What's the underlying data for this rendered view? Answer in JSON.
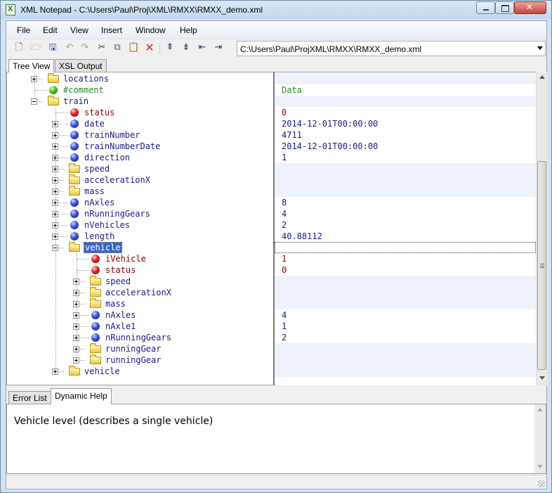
{
  "window": {
    "title": "XML Notepad - C:\\Users\\Paul\\Proj\\XML\\RMXX\\RMXX_demo.xml"
  },
  "menu": [
    "File",
    "Edit",
    "View",
    "Insert",
    "Window",
    "Help"
  ],
  "toolbar": {
    "icons": [
      "new-file-icon",
      "open-folder-icon",
      "save-icon",
      "undo-icon",
      "redo-icon",
      "cut-icon",
      "copy-icon",
      "paste-icon",
      "delete-icon",
      "nudge-up-icon",
      "nudge-down-icon",
      "nudge-left-icon",
      "nudge-right-icon"
    ],
    "path_value": "C:\\Users\\Paul\\ProjXML\\RMXX\\RMXX_demo.xml"
  },
  "tabs_top": [
    "Tree View",
    "XSL Output"
  ],
  "active_tab_top": "Tree View",
  "tree": [
    {
      "level": 1,
      "expander": "plus",
      "icon": "folder",
      "label": "locations",
      "kind": "el",
      "value": ""
    },
    {
      "level": 1,
      "expander": "none",
      "icon": "green",
      "label": "#comment",
      "kind": "comment",
      "value": "Data"
    },
    {
      "level": 1,
      "expander": "minus",
      "icon": "folder",
      "label": "train",
      "kind": "el",
      "value": ""
    },
    {
      "level": 2,
      "expander": "none",
      "icon": "red",
      "label": "status",
      "kind": "attr",
      "value": "0"
    },
    {
      "level": 2,
      "expander": "plus",
      "icon": "blue",
      "label": "date",
      "kind": "el",
      "value": "2014-12-01T00:00:00"
    },
    {
      "level": 2,
      "expander": "plus",
      "icon": "blue",
      "label": "trainNumber",
      "kind": "el",
      "value": "4711"
    },
    {
      "level": 2,
      "expander": "plus",
      "icon": "blue",
      "label": "trainNumberDate",
      "kind": "el",
      "value": "2014-12-01T00:00:00"
    },
    {
      "level": 2,
      "expander": "plus",
      "icon": "blue",
      "label": "direction",
      "kind": "el",
      "value": "1"
    },
    {
      "level": 2,
      "expander": "plus",
      "icon": "folder",
      "label": "speed",
      "kind": "el",
      "value": ""
    },
    {
      "level": 2,
      "expander": "plus",
      "icon": "folder",
      "label": "accelerationX",
      "kind": "el",
      "value": ""
    },
    {
      "level": 2,
      "expander": "plus",
      "icon": "folder",
      "label": "mass",
      "kind": "el",
      "value": ""
    },
    {
      "level": 2,
      "expander": "plus",
      "icon": "blue",
      "label": "nAxles",
      "kind": "el",
      "value": "8"
    },
    {
      "level": 2,
      "expander": "plus",
      "icon": "blue",
      "label": "nRunningGears",
      "kind": "el",
      "value": "4"
    },
    {
      "level": 2,
      "expander": "plus",
      "icon": "blue",
      "label": "nVehicles",
      "kind": "el",
      "value": "2"
    },
    {
      "level": 2,
      "expander": "plus",
      "icon": "blue",
      "label": "length",
      "kind": "el",
      "value": "40.88112"
    },
    {
      "level": 2,
      "expander": "minus",
      "icon": "folder",
      "label": "vehicle",
      "kind": "el",
      "value": "",
      "selected": true
    },
    {
      "level": 3,
      "expander": "none",
      "icon": "red",
      "label": "iVehicle",
      "kind": "attr",
      "value": "1"
    },
    {
      "level": 3,
      "expander": "none",
      "icon": "red",
      "label": "status",
      "kind": "attr",
      "value": "0"
    },
    {
      "level": 3,
      "expander": "plus",
      "icon": "folder",
      "label": "speed",
      "kind": "el",
      "value": ""
    },
    {
      "level": 3,
      "expander": "plus",
      "icon": "folder",
      "label": "accelerationX",
      "kind": "el",
      "value": ""
    },
    {
      "level": 3,
      "expander": "plus",
      "icon": "folder",
      "label": "mass",
      "kind": "el",
      "value": ""
    },
    {
      "level": 3,
      "expander": "plus",
      "icon": "blue",
      "label": "nAxles",
      "kind": "el",
      "value": "4"
    },
    {
      "level": 3,
      "expander": "plus",
      "icon": "blue",
      "label": "nAxle1",
      "kind": "el",
      "value": "1"
    },
    {
      "level": 3,
      "expander": "plus",
      "icon": "blue",
      "label": "nRunningGears",
      "kind": "el",
      "value": "2"
    },
    {
      "level": 3,
      "expander": "plus",
      "icon": "folder",
      "label": "runningGear",
      "kind": "el",
      "value": ""
    },
    {
      "level": 3,
      "expander": "plus",
      "icon": "folder",
      "label": "runningGear",
      "kind": "el",
      "value": ""
    },
    {
      "level": 2,
      "expander": "plus",
      "icon": "folder",
      "label": "vehicle",
      "kind": "el",
      "value": ""
    }
  ],
  "tabs_bottom": [
    "Error List",
    "Dynamic Help"
  ],
  "active_tab_bottom": "Dynamic Help",
  "help": {
    "text": "Vehicle level (describes a single vehicle)"
  },
  "colors": {
    "element": "#1a1a8c",
    "attribute": "#8b0000",
    "comment": "#228b22",
    "selection": "#3366cc",
    "shade": "#eef3fb"
  }
}
